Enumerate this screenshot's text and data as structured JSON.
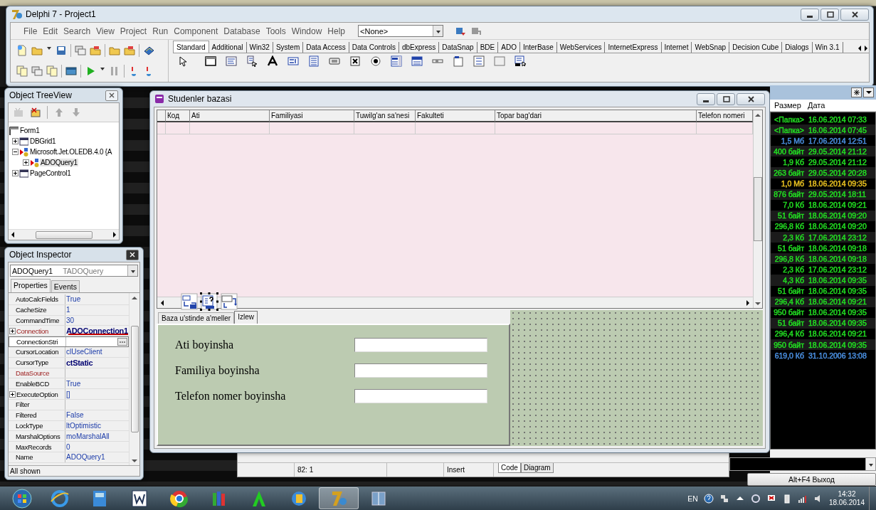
{
  "main_window": {
    "title": "Delphi 7 - Project1",
    "menu": [
      "File",
      "Edit",
      "Search",
      "View",
      "Project",
      "Run",
      "Component",
      "Database",
      "Tools",
      "Window",
      "Help"
    ],
    "target_combo": "<None>",
    "palette_tabs": [
      {
        "label": "Standard",
        "selected": true
      },
      {
        "label": "Additional",
        "selected": false
      },
      {
        "label": "Win32",
        "selected": false
      },
      {
        "label": "System",
        "selected": false
      },
      {
        "label": "Data Access",
        "selected": false
      },
      {
        "label": "Data Controls",
        "selected": false
      },
      {
        "label": "dbExpress",
        "selected": false
      },
      {
        "label": "DataSnap",
        "selected": false
      },
      {
        "label": "BDE",
        "selected": false
      },
      {
        "label": "ADO",
        "selected": false
      },
      {
        "label": "InterBase",
        "selected": false
      },
      {
        "label": "WebServices",
        "selected": false
      },
      {
        "label": "InternetExpress",
        "selected": false
      },
      {
        "label": "Internet",
        "selected": false
      },
      {
        "label": "WebSnap",
        "selected": false
      },
      {
        "label": "Decision Cube",
        "selected": false
      },
      {
        "label": "Dialogs",
        "selected": false
      },
      {
        "label": "Win 3.1",
        "selected": false
      }
    ]
  },
  "tree_view": {
    "title": "Object TreeView",
    "root": "Form1",
    "items": [
      {
        "label": "DBGrid1",
        "expanded": false,
        "selected": false
      },
      {
        "label": "Microsoft.Jet.OLEDB.4.0 {A",
        "expanded": true,
        "selected": false,
        "children": [
          {
            "label": "ADOQuery1",
            "expanded": false,
            "selected": true
          }
        ]
      },
      {
        "label": "PageControl1",
        "expanded": false,
        "selected": false
      }
    ]
  },
  "object_inspector": {
    "title": "Object Inspector",
    "object": "ADOQuery1",
    "object_type": "TADOQuery",
    "tabs": [
      {
        "label": "Properties",
        "selected": true
      },
      {
        "label": "Events",
        "selected": false
      }
    ],
    "properties": [
      {
        "name": "AutoCalcFields",
        "value": "True",
        "expandable": false,
        "reference": false,
        "modified": false,
        "selected": false,
        "underlined": false
      },
      {
        "name": "CacheSize",
        "value": "1",
        "expandable": false,
        "reference": false,
        "modified": false,
        "selected": false,
        "underlined": false
      },
      {
        "name": "CommandTime",
        "value": "30",
        "expandable": false,
        "reference": false,
        "modified": false,
        "selected": false,
        "underlined": false
      },
      {
        "name": "Connection",
        "value": "ADOConnection1",
        "expandable": true,
        "reference": true,
        "modified": true,
        "selected": false,
        "underlined": true
      },
      {
        "name": "ConnectionStri",
        "expandable": false,
        "reference": false,
        "selected": true,
        "underlined": false
      },
      {
        "name": "CursorLocation",
        "value": "clUseClient",
        "expandable": false,
        "reference": false,
        "modified": false,
        "selected": false,
        "underlined": false
      },
      {
        "name": "CursorType",
        "value": "ctStatic",
        "expandable": false,
        "reference": false,
        "modified": true,
        "selected": false,
        "underlined": false
      },
      {
        "name": "DataSource",
        "expandable": false,
        "reference": true,
        "selected": false,
        "underlined": false
      },
      {
        "name": "EnableBCD",
        "value": "True",
        "expandable": false,
        "reference": false,
        "modified": false,
        "selected": false,
        "underlined": false
      },
      {
        "name": "ExecuteOption",
        "value": "[]",
        "expandable": true,
        "reference": false,
        "modified": false,
        "selected": false,
        "underlined": false
      },
      {
        "name": "Filter",
        "expandable": false,
        "reference": false,
        "selected": false,
        "underlined": false
      },
      {
        "name": "Filtered",
        "value": "False",
        "expandable": false,
        "reference": false,
        "modified": false,
        "selected": false,
        "underlined": false
      },
      {
        "name": "LockType",
        "value": "ltOptimistic",
        "expandable": false,
        "reference": false,
        "modified": false,
        "selected": false,
        "underlined": false
      },
      {
        "name": "MarshalOptions",
        "value": "moMarshalAll",
        "expandable": false,
        "reference": false,
        "modified": false,
        "selected": false,
        "underlined": false
      },
      {
        "name": "MaxRecords",
        "value": "0",
        "expandable": false,
        "reference": false,
        "modified": false,
        "selected": false,
        "underlined": false
      },
      {
        "name": "Name",
        "value": "ADOQuery1",
        "expandable": false,
        "reference": false,
        "modified": false,
        "selected": false,
        "underlined": false
      }
    ],
    "status": "All shown"
  },
  "form_window": {
    "title": "Studenler bazasi",
    "grid": {
      "columns": [
        "Код",
        "Ati",
        "Familiyasi",
        "Tuwilg'an sa'nesi",
        "Fakulteti",
        "Topar bag'dari",
        "Telefon nomeri"
      ]
    },
    "components": [
      {
        "kind": "connection",
        "selected": false
      },
      {
        "kind": "query",
        "selected": true
      },
      {
        "kind": "command",
        "selected": false
      }
    ],
    "tabs": [
      {
        "label": "Baza u'stinde a'meller",
        "selected": false
      },
      {
        "label": "Izlew",
        "selected": true
      }
    ],
    "search_fields": [
      {
        "label": "Ati boyinsha"
      },
      {
        "label": "Familiya boyinsha"
      },
      {
        "label": "Telefon nomer boyinsha"
      }
    ]
  },
  "code_editor": {
    "position": "82:  1",
    "mode": "Insert",
    "tabs": [
      {
        "label": "Code",
        "selected": true
      },
      {
        "label": "Diagram",
        "selected": false
      }
    ]
  },
  "file_panel": {
    "columns": [
      "Размер",
      "Дата"
    ],
    "rows": [
      {
        "size": "<Папка>",
        "date": "16.06.2014 07:33",
        "color": "#22dd22"
      },
      {
        "size": "<Папка>",
        "date": "16.06.2014 07:45",
        "color": "#22dd22"
      },
      {
        "size": "1,5 Мб",
        "date": "17.06.2014 12:51",
        "color": "#4a8fe0"
      },
      {
        "size": "400 байт",
        "date": "29.05.2014 21:12",
        "color": "#22dd22"
      },
      {
        "size": "1,9 Кб",
        "date": "29.05.2014 21:12",
        "color": "#22dd22"
      },
      {
        "size": "263 байт",
        "date": "29.05.2014 20:28",
        "color": "#22dd22"
      },
      {
        "size": "1,0 Мб",
        "date": "18.06.2014 09:35",
        "color": "#e8c020"
      },
      {
        "size": "876 байт",
        "date": "29.05.2014 18:11",
        "color": "#22dd22"
      },
      {
        "size": "7,0 Кб",
        "date": "18.06.2014 09:21",
        "color": "#22dd22"
      },
      {
        "size": "51 байт",
        "date": "18.06.2014 09:20",
        "color": "#22dd22"
      },
      {
        "size": "296,8 Кб",
        "date": "18.06.2014 09:20",
        "color": "#22dd22"
      },
      {
        "size": "2,3 Кб",
        "date": "17.06.2014 23:12",
        "color": "#22dd22"
      },
      {
        "size": "51 байт",
        "date": "18.06.2014 09:18",
        "color": "#22dd22"
      },
      {
        "size": "296,8 Кб",
        "date": "18.06.2014 09:18",
        "color": "#22dd22"
      },
      {
        "size": "2,3 Кб",
        "date": "17.06.2014 23:12",
        "color": "#22dd22"
      },
      {
        "size": "4,3 Кб",
        "date": "18.06.2014 09:35",
        "color": "#22dd22"
      },
      {
        "size": "51 байт",
        "date": "18.06.2014 09:35",
        "color": "#22dd22"
      },
      {
        "size": "296,4 Кб",
        "date": "18.06.2014 09:21",
        "color": "#22dd22"
      },
      {
        "size": "950 байт",
        "date": "18.06.2014 09:35",
        "color": "#22dd22"
      },
      {
        "size": "51 байт",
        "date": "18.06.2014 09:35",
        "color": "#22dd22"
      },
      {
        "size": "296,4 Кб",
        "date": "18.06.2014 09:21",
        "color": "#22dd22"
      },
      {
        "size": "950 байт",
        "date": "18.06.2014 09:35",
        "color": "#22dd22"
      },
      {
        "size": "619,0 Кб",
        "date": "31.10.2006 13:08",
        "color": "#4a8fe0"
      }
    ],
    "exit_button": "Alt+F4 Выход"
  },
  "taskbar": {
    "language": "EN",
    "time": "14:32",
    "date": "18.06.2014"
  }
}
